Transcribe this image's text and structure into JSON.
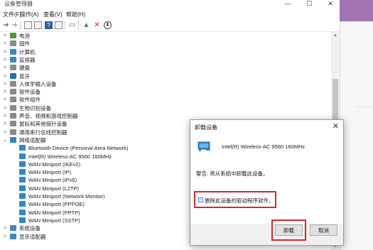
{
  "window": {
    "title": "设备管理器",
    "controls": [
      "—",
      "☐",
      "✕"
    ]
  },
  "menu": [
    "文件(F)",
    "操作(A)",
    "查看(V)",
    "帮助(H)"
  ],
  "toolbar": {
    "icons": [
      "back-icon",
      "forward-icon",
      "properties-icon",
      "help-icon",
      "update-driver-icon",
      "monitor-icon",
      "add-driver-icon",
      "uninstall-x-icon",
      "download-icon"
    ]
  },
  "tree": {
    "categories_top": [
      {
        "label": "电池",
        "icon": "battery-icon",
        "color": "#4b9a3c"
      },
      {
        "label": "固件",
        "icon": "firmware-icon",
        "color": "#8a8a8a"
      },
      {
        "label": "计算机",
        "icon": "computer-icon",
        "color": "#3a86c8"
      },
      {
        "label": "监视器",
        "icon": "monitor-icon",
        "color": "#3a86c8"
      },
      {
        "label": "键盘",
        "icon": "keyboard-icon",
        "color": "#8a8a8a"
      },
      {
        "label": "蓝牙",
        "icon": "bluetooth-icon",
        "color": "#1f6fc4"
      },
      {
        "label": "人体学输入设备",
        "icon": "hid-icon",
        "color": "#8a8a8a"
      },
      {
        "label": "软件设备",
        "icon": "software-device-icon",
        "color": "#8a8a8a"
      },
      {
        "label": "软件组件",
        "icon": "software-component-icon",
        "color": "#8a8a8a"
      },
      {
        "label": "生物识别设备",
        "icon": "biometric-icon",
        "color": "#8a8a8a"
      },
      {
        "label": "声音、视频和游戏控制器",
        "icon": "speaker-icon",
        "color": "#8a8a8a"
      },
      {
        "label": "鼠标和其他指针设备",
        "icon": "mouse-icon",
        "color": "#8a8a8a"
      },
      {
        "label": "通用串行总线控制器",
        "icon": "usb-icon",
        "color": "#8a8a8a"
      }
    ],
    "network_category": "网络适配器",
    "network_children": [
      "Bluetooth Device (Personal Area Network)",
      "Intel(R) Wireless-AC 9560 160MHz",
      "WAN Miniport (IKEv2)",
      "WAN Miniport (IP)",
      "WAN Miniport (IPv6)",
      "WAN Miniport (L2TP)",
      "WAN Miniport (Network Monitor)",
      "WAN Miniport (PPPOE)",
      "WAN Miniport (PPTP)",
      "WAN Miniport (SSTP)"
    ],
    "categories_bottom": [
      {
        "label": "系统设备",
        "icon": "system-device-icon",
        "color": "#3a86c8"
      },
      {
        "label": "显示适配器",
        "icon": "display-adapter-icon",
        "color": "#3a86c8"
      }
    ]
  },
  "dialog": {
    "title": "卸载设备",
    "device_name": "Intel(R) Wireless-AC 9560 160MHz",
    "warning": "警告: 将从系统中卸载此设备。",
    "checkbox_label": "删除此设备的驱动程序软件。",
    "checkbox_checked": true,
    "uninstall_label": "卸载",
    "cancel_label": "取消",
    "highlight_color": "#d9262a"
  }
}
